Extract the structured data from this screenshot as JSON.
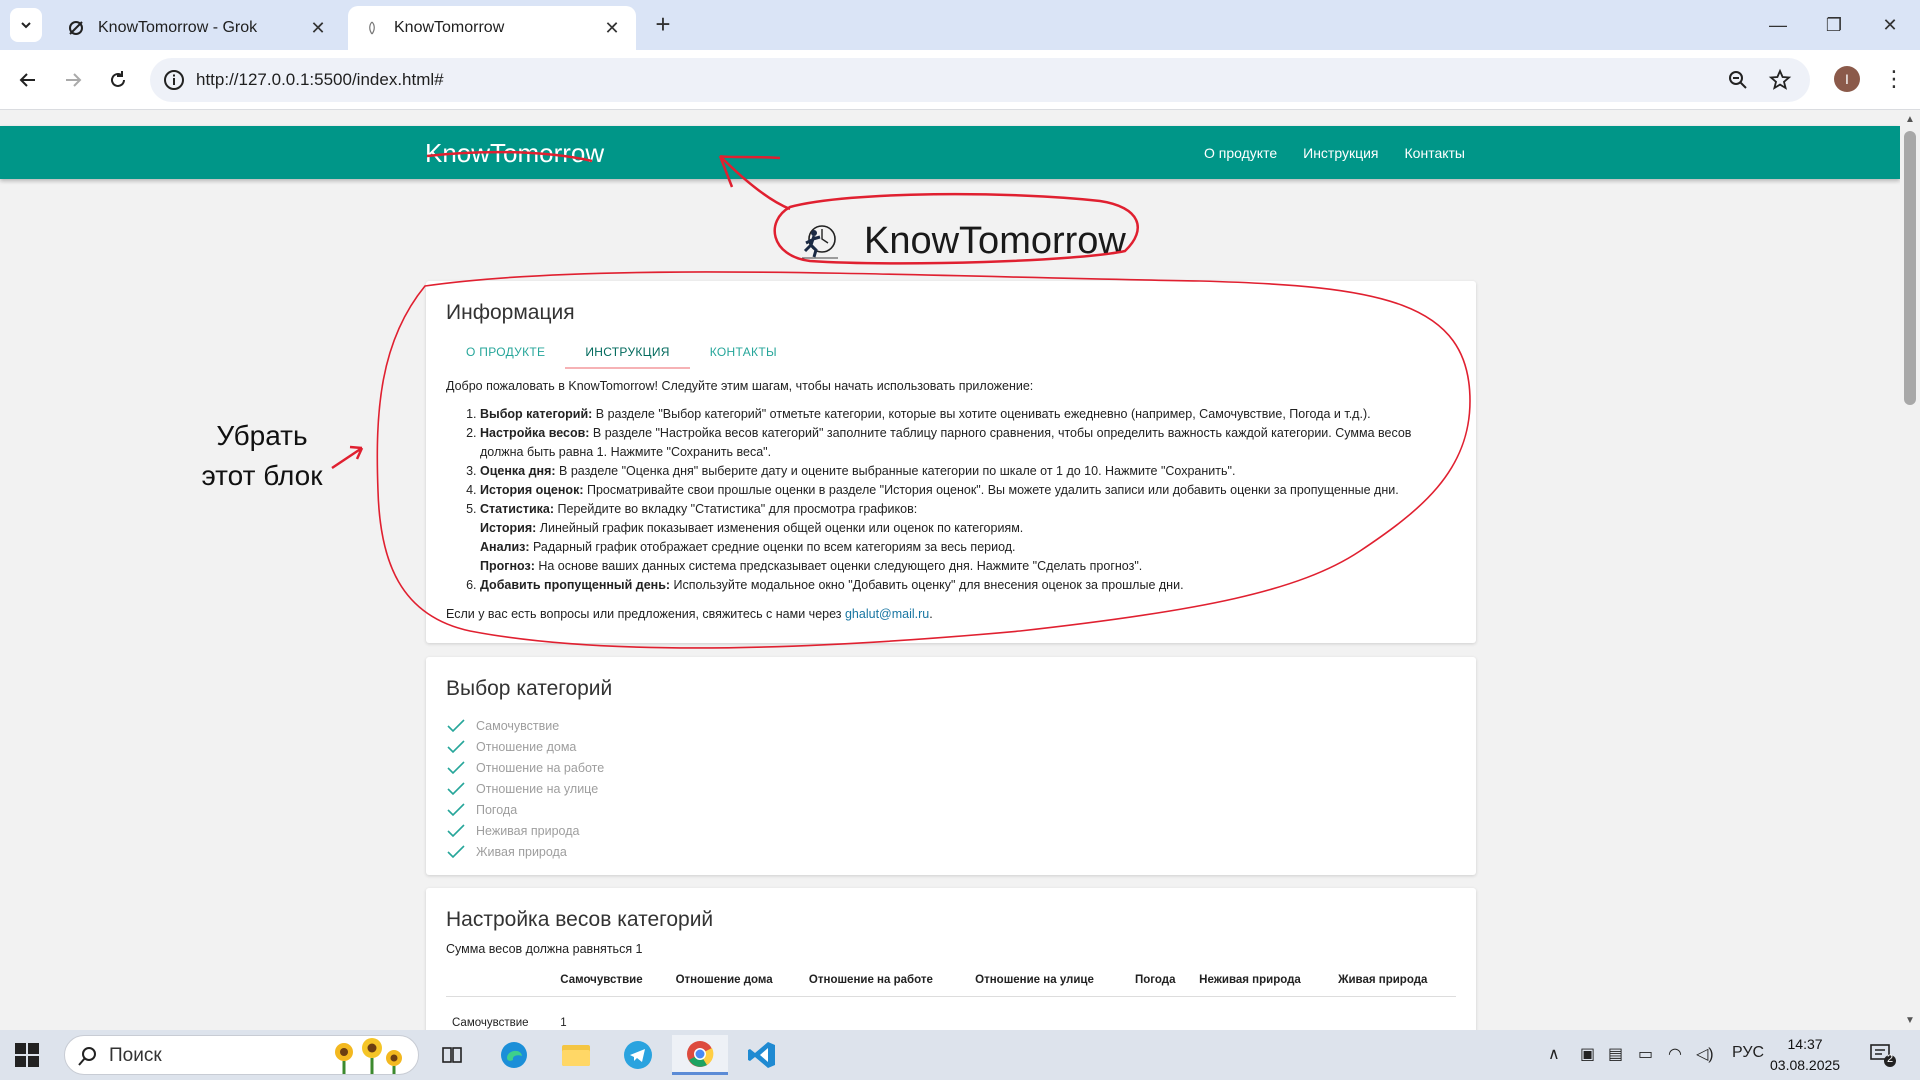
{
  "browser": {
    "tabs": [
      {
        "label": "KnowTomorrow - Grok",
        "active": false
      },
      {
        "label": "KnowTomorrow",
        "active": true
      }
    ],
    "new_tab": "+",
    "url": "http://127.0.0.1:5500/index.html#",
    "avatar_letter": "I"
  },
  "app": {
    "brand": "KnowTomorrow",
    "nav": [
      "О продукте",
      "Инструкция",
      "Контакты"
    ],
    "hero_title": "KnowTomorrow"
  },
  "info": {
    "title": "Информация",
    "tabs": [
      "О ПРОДУКТЕ",
      "ИНСТРУКЦИЯ",
      "КОНТАКТЫ"
    ],
    "active_tab": 1,
    "intro": "Добро пожаловать в KnowTomorrow! Следуйте этим шагам, чтобы начать использовать приложение:",
    "steps": [
      {
        "bold": "Выбор категорий:",
        "text": " В разделе \"Выбор категорий\" отметьте категории, которые вы хотите оценивать ежедневно (например, Самочувствие, Погода и т.д.)."
      },
      {
        "bold": "Настройка весов:",
        "text": " В разделе \"Настройка весов категорий\" заполните таблицу парного сравнения, чтобы определить важность каждой категории. Сумма весов должна быть равна 1. Нажмите \"Сохранить веса\"."
      },
      {
        "bold": "Оценка дня:",
        "text": " В разделе \"Оценка дня\" выберите дату и оцените выбранные категории по шкале от 1 до 10. Нажмите \"Сохранить\"."
      },
      {
        "bold": "История оценок:",
        "text": " Просматривайте свои прошлые оценки в разделе \"История оценок\". Вы можете удалить записи или добавить оценки за пропущенные дни."
      },
      {
        "bold": "Статистика:",
        "text": " Перейдите во вкладку \"Статистика\" для просмотра графиков:"
      },
      {
        "bold": "Добавить пропущенный день:",
        "text": " Используйте модальное окно \"Добавить оценку\" для внесения оценок за прошлые дни."
      }
    ],
    "stats_sub": [
      {
        "bold": "История:",
        "text": " Линейный график показывает изменения общей оценки или оценок по категориям."
      },
      {
        "bold": "Анализ:",
        "text": " Радарный график отображает средние оценки по всем категориям за весь период."
      },
      {
        "bold": "Прогноз:",
        "text": " На основе ваших данных система предсказывает оценки следующего дня. Нажмите \"Сделать прогноз\"."
      }
    ],
    "contact_prefix": "Если у вас есть вопросы или предложения, свяжитесь с нами через ",
    "contact_email": "ghalut@mail.ru",
    "contact_suffix": "."
  },
  "categories": {
    "title": "Выбор категорий",
    "items": [
      "Самочувствие",
      "Отношение дома",
      "Отношение на работе",
      "Отношение на улице",
      "Погода",
      "Неживая природа",
      "Живая природа"
    ]
  },
  "weights": {
    "title": "Настройка весов категорий",
    "note": "Сумма весов должна равняться 1",
    "columns": [
      "",
      "Самочувствие",
      "Отношение дома",
      "Отношение на работе",
      "Отношение на улице",
      "Погода",
      "Неживая природа",
      "Живая природа"
    ],
    "rows": [
      [
        "Самочувствие",
        "1",
        "",
        "",
        "",
        "",
        "",
        ""
      ]
    ]
  },
  "annotation": {
    "text_line1": "Убрать",
    "text_line2": "этот блок",
    "color": "#e02030"
  },
  "taskbar": {
    "search_placeholder": "Поиск",
    "lang": "РУС",
    "time": "14:37",
    "date": "03.08.2025",
    "notifications": "2"
  }
}
